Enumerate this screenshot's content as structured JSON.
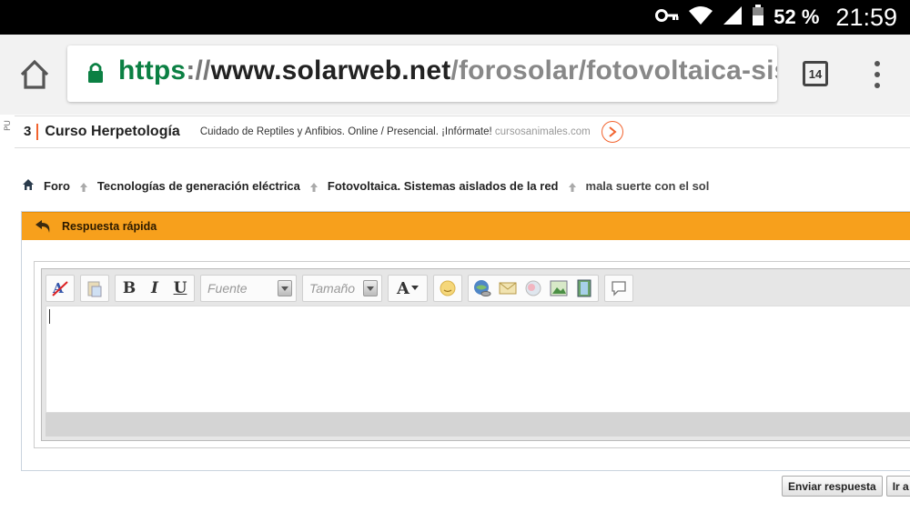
{
  "status_bar": {
    "battery": "52 %",
    "time": "21:59"
  },
  "browser": {
    "url_scheme": "https",
    "url_sep": "://",
    "url_host": "www.solarweb.net",
    "url_path": "/forosolar/fotovoltaica-siste",
    "tab_count": "14"
  },
  "ad": {
    "side_label": "PU",
    "number": "3",
    "title": "Curso Herpetología",
    "description": "Cuidado de Reptiles y Anfibios. Online / Presencial. ¡Infórmate!",
    "domain": "cursosanimales.com"
  },
  "breadcrumb": {
    "items": [
      "Foro",
      "Tecnologías de generación eléctrica",
      "Fotovoltaica. Sistemas aislados de la red"
    ],
    "current": "mala suerte con el sol"
  },
  "reply": {
    "title": "Respuesta rápida",
    "font_placeholder": "Fuente",
    "size_placeholder": "Tamaño"
  },
  "buttons": {
    "send": "Enviar respuesta",
    "advanced": "Ir a"
  },
  "colors": {
    "accent_orange": "#f7a01c",
    "secure_green": "#0b8043",
    "ad_accent": "#f2632e"
  }
}
